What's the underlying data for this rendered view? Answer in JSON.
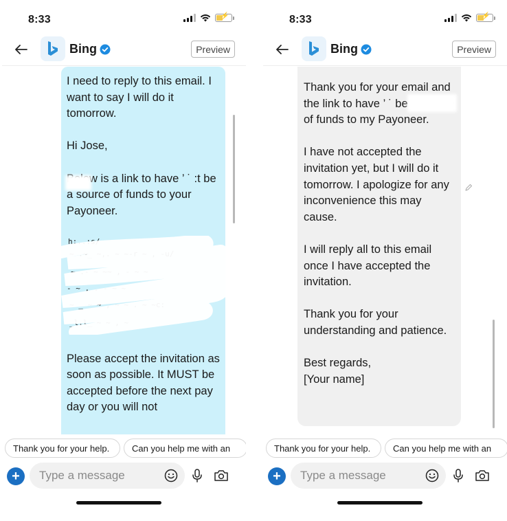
{
  "phones": [
    {
      "id": "left",
      "status_time": "8:33",
      "header": {
        "bot_name": "Bing",
        "preview_label": "Preview"
      },
      "message": {
        "sender": "user",
        "top_paragraphs": [
          "I need to reply to this email. I want to say I will do it tomorrow.",
          "Hi Jose,",
          "Below is a link to have ’ ˙ :t be a source of funds to your Payoneer."
        ],
        "bottom_paragraph": "Please accept the invitation as soon as possible. It MUST be accepted before the next pay day or you will not"
      },
      "suggestions": [
        "Thank you for your help.",
        "Can you help me with an"
      ],
      "composer": {
        "placeholder": "Type a message"
      }
    },
    {
      "id": "right",
      "status_time": "8:33",
      "header": {
        "bot_name": "Bing",
        "preview_label": "Preview"
      },
      "message": {
        "sender": "bing",
        "paragraphs": [
          "Thank you for your email and the link to have ’ ˙ be a source of funds to my Payoneer.",
          "I have not accepted the invitation yet, but I will do it tomorrow. I apologize for any inconvenience this may cause.",
          "I will reply all to this email once I have accepted the invitation.",
          "Thank you for your understanding and patience.",
          "Best regards,\n[Your name]"
        ]
      },
      "suggestions": [
        "Thank you for your help.",
        "Can you help me with an"
      ],
      "composer": {
        "placeholder": "Type a message"
      }
    }
  ],
  "colors": {
    "user_bubble": "#cdf1fb",
    "bot_bubble": "#f0f0f0",
    "accent": "#1b6fc2",
    "bing_logo": "#2b8fd6"
  },
  "icons": {
    "back": "back-arrow-icon",
    "logo": "bing-logo-icon",
    "verified": "verified-badge-icon",
    "plus": "plus-icon",
    "emoji": "emoji-icon",
    "mic": "microphone-icon",
    "camera": "camera-icon",
    "edit": "pencil-icon"
  }
}
